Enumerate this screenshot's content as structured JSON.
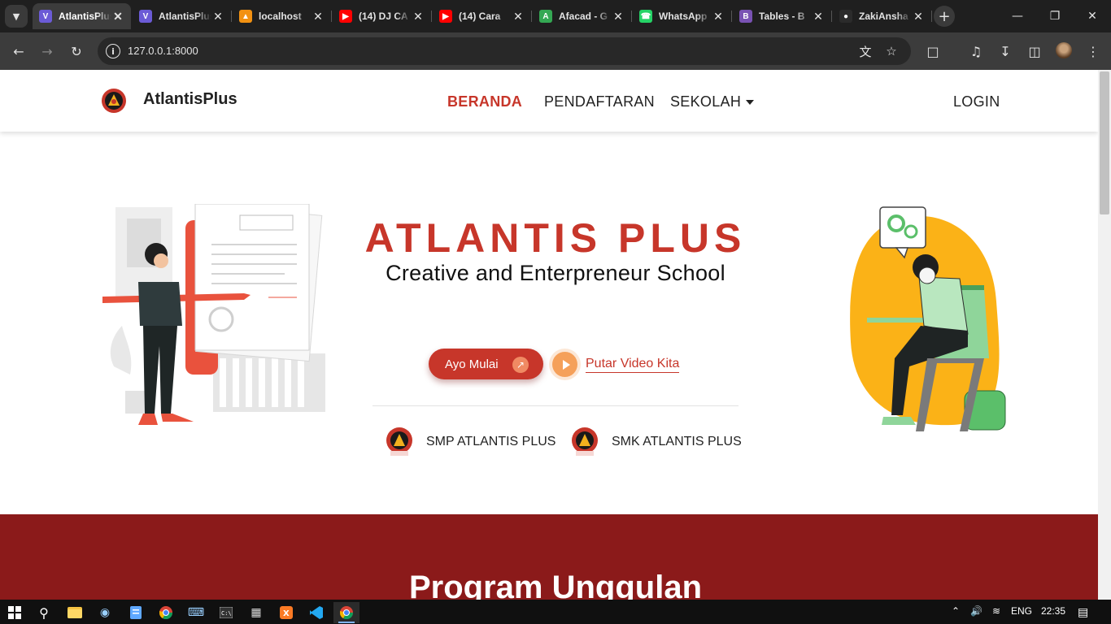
{
  "browser": {
    "tabs": [
      {
        "title": "AtlantisPlus",
        "icon": "laravel-icon",
        "color": "#6b5bd6",
        "active": true
      },
      {
        "title": "AtlantisPlus",
        "icon": "laravel-icon",
        "color": "#6b5bd6",
        "active": false
      },
      {
        "title": "localhost",
        "icon": "phpmyadmin-icon",
        "color": "#f29111",
        "active": false
      },
      {
        "title": "(14) DJ CA",
        "icon": "youtube-icon",
        "color": "#ff0000",
        "active": false
      },
      {
        "title": "(14) Cara",
        "icon": "youtube-icon",
        "color": "#ff0000",
        "active": false
      },
      {
        "title": "Afacad - G",
        "icon": "google-fonts-icon",
        "color": "#34a853",
        "active": false
      },
      {
        "title": "WhatsApp",
        "icon": "whatsapp-icon",
        "color": "#25d366",
        "active": false
      },
      {
        "title": "Tables - B",
        "icon": "bootstrap-icon",
        "color": "#7952b3",
        "active": false
      },
      {
        "title": "ZakiAnsha",
        "icon": "github-icon",
        "color": "#2b2b2b",
        "active": false
      }
    ],
    "url": "127.0.0.1:8000"
  },
  "nav": {
    "brand": "AtlantisPlus",
    "links": {
      "beranda": "BERANDA",
      "pendaftaran": "PENDAFTARAN",
      "sekolah": "SEKOLAH",
      "login": "LOGIN"
    },
    "active_color": "#c7362a"
  },
  "hero": {
    "title": "ATLANTIS PLUS",
    "subtitle": "Creative and Enterpreneur School",
    "cta_label": "Ayo Mulai",
    "video_label": "Putar Video Kita",
    "schools": [
      {
        "name": "SMP ATLANTIS PLUS"
      },
      {
        "name": "SMK ATLANTIS PLUS"
      }
    ]
  },
  "program": {
    "heading": "Program Unggulan",
    "background": "#8b1a1a"
  },
  "taskbar": {
    "language": "ENG",
    "time": "22:35"
  }
}
